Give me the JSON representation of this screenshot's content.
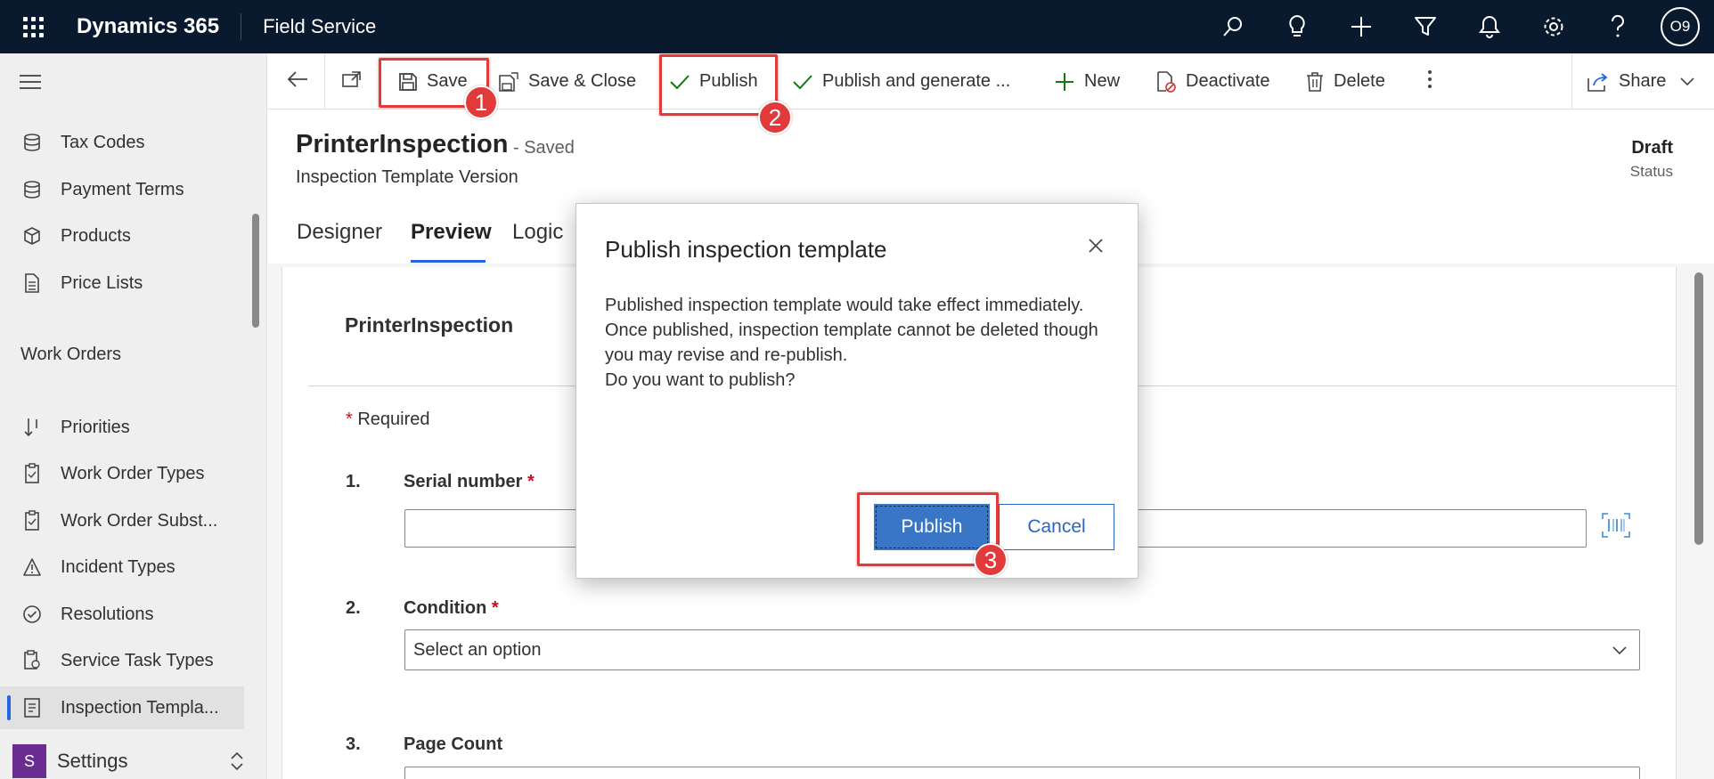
{
  "topbar": {
    "brand": "Dynamics 365",
    "app_name": "Field Service",
    "user_initials": "O9",
    "icons": [
      "search-icon",
      "lightbulb-icon",
      "plus-icon",
      "filter-icon",
      "bell-icon",
      "gear-icon",
      "help-icon"
    ]
  },
  "sidebar": {
    "items": [
      {
        "label": "Tax Codes",
        "icon": "database-icon"
      },
      {
        "label": "Payment Terms",
        "icon": "database-icon"
      },
      {
        "label": "Products",
        "icon": "cube-icon"
      },
      {
        "label": "Price Lists",
        "icon": "document-icon"
      }
    ],
    "section_title": "Work Orders",
    "work_order_items": [
      {
        "label": "Priorities",
        "icon": "sort-icon"
      },
      {
        "label": "Work Order Types",
        "icon": "clipboard-icon"
      },
      {
        "label": "Work Order Subst...",
        "icon": "clipboard-icon"
      },
      {
        "label": "Incident Types",
        "icon": "warning-icon"
      },
      {
        "label": "Resolutions",
        "icon": "check-circle-icon"
      },
      {
        "label": "Service Task Types",
        "icon": "clipboard-gear-icon"
      },
      {
        "label": "Inspection Templa...",
        "icon": "checklist-icon",
        "selected": true
      }
    ],
    "area_badge": "S",
    "area_label": "Settings"
  },
  "commands": {
    "save": "Save",
    "save_close": "Save & Close",
    "publish": "Publish",
    "publish_generate": "Publish and generate ...",
    "new": "New",
    "deactivate": "Deactivate",
    "delete": "Delete",
    "share": "Share"
  },
  "form": {
    "title": "PrinterInspection",
    "saved": "- Saved",
    "entity": "Inspection Template Version",
    "status_value": "Draft",
    "status_label": "Status",
    "tabs": [
      "Designer",
      "Preview",
      "Logic"
    ],
    "active_tab": "Preview"
  },
  "preview": {
    "name": "PrinterInspection",
    "required_star": "*",
    "required_text": "Required",
    "questions": [
      {
        "number": "1.",
        "label": "Serial number",
        "required": true
      },
      {
        "number": "2.",
        "label": "Condition",
        "required": true,
        "placeholder": "Select an option"
      },
      {
        "number": "3.",
        "label": "Page Count",
        "required": false
      }
    ]
  },
  "dialog": {
    "title": "Publish inspection template",
    "body_lines": [
      "Published inspection template would take effect immediately.",
      "Once published, inspection template cannot be deleted though you may revise and re-publish.",
      "Do you want to publish?"
    ],
    "primary_button": "Publish",
    "secondary_button": "Cancel"
  },
  "callouts": [
    "1",
    "2",
    "3"
  ],
  "colors": {
    "topbar": "#0a1a2e",
    "accent": "#2266e3",
    "primary_button": "#3a76c6",
    "callout": "#e03a3a",
    "settings_badge": "#6b2c91"
  }
}
